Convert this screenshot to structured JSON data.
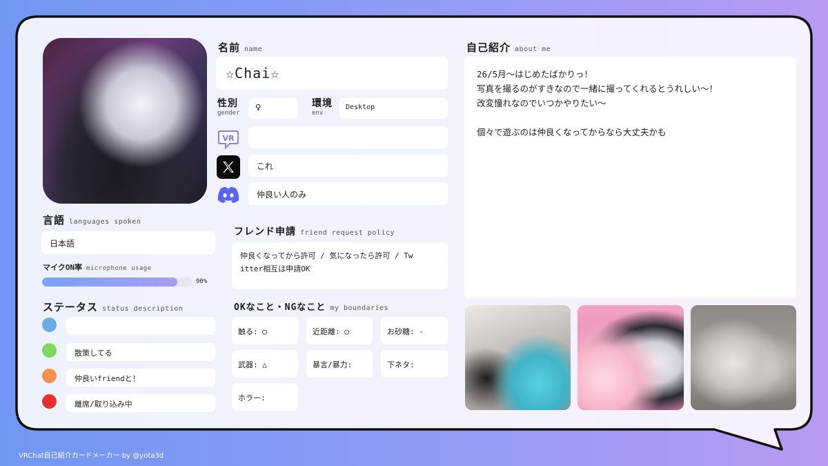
{
  "profile": {
    "name_label": "名前",
    "name_sub": "name",
    "name_value": "☆Chai☆",
    "gender_label": "性別",
    "gender_sub": "gender",
    "gender_value": "♀",
    "env_label": "環境",
    "env_sub": "env",
    "env_value": "Desktop",
    "vrchat_value": "",
    "x_value": "これ",
    "discord_value": "仲良い人のみ"
  },
  "language": {
    "label": "言語",
    "sub": "languages spoken",
    "value": "日本語"
  },
  "mic": {
    "label": "マイクON率",
    "sub": "microphone usage",
    "percent_text": "90%",
    "fraction": 0.9
  },
  "status": {
    "label": "ステータス",
    "sub": "status description",
    "items": [
      {
        "color": "#6aace6",
        "text": ""
      },
      {
        "color": "#7ed957",
        "text": "散策してる"
      },
      {
        "color": "#f2914d",
        "text": "仲良いfriendと！"
      },
      {
        "color": "#e5322d",
        "text": "離席/取り込み中"
      }
    ]
  },
  "friend": {
    "label": "フレンド申請",
    "sub": "friend request policy",
    "line1": "仲良くなってから許可 / 気になったら許可 / Tw",
    "line2": "itter相互は申請OK"
  },
  "boundaries": {
    "label": "OKなこと・NGなこと",
    "sub": "my boundaries",
    "items": [
      {
        "text": "触る: ◯"
      },
      {
        "text": "近距離: ◯"
      },
      {
        "text": "お砂糖: -"
      },
      {
        "text": "武器: △"
      },
      {
        "text": "暴言/暴力:"
      },
      {
        "text": "下ネタ:"
      },
      {
        "text": "ホラー:"
      }
    ]
  },
  "about": {
    "label": "自己紹介",
    "sub": "about me",
    "lines": [
      "26/5月〜はじめたばかりっ！",
      "写真を撮るのがすきなので一緒に撮ってくれるとうれしい〜！",
      "改変憧れなのでいつかやりたい〜",
      "",
      "個々で遊ぶのは仲良くなってからなら大丈夫かも"
    ]
  },
  "icons": {
    "vrchat": "vrchat-logo-icon",
    "x": "x-logo-icon",
    "discord": "discord-logo-icon"
  },
  "footer": "VRChat自己紹介カードメーカー by @yota3d"
}
